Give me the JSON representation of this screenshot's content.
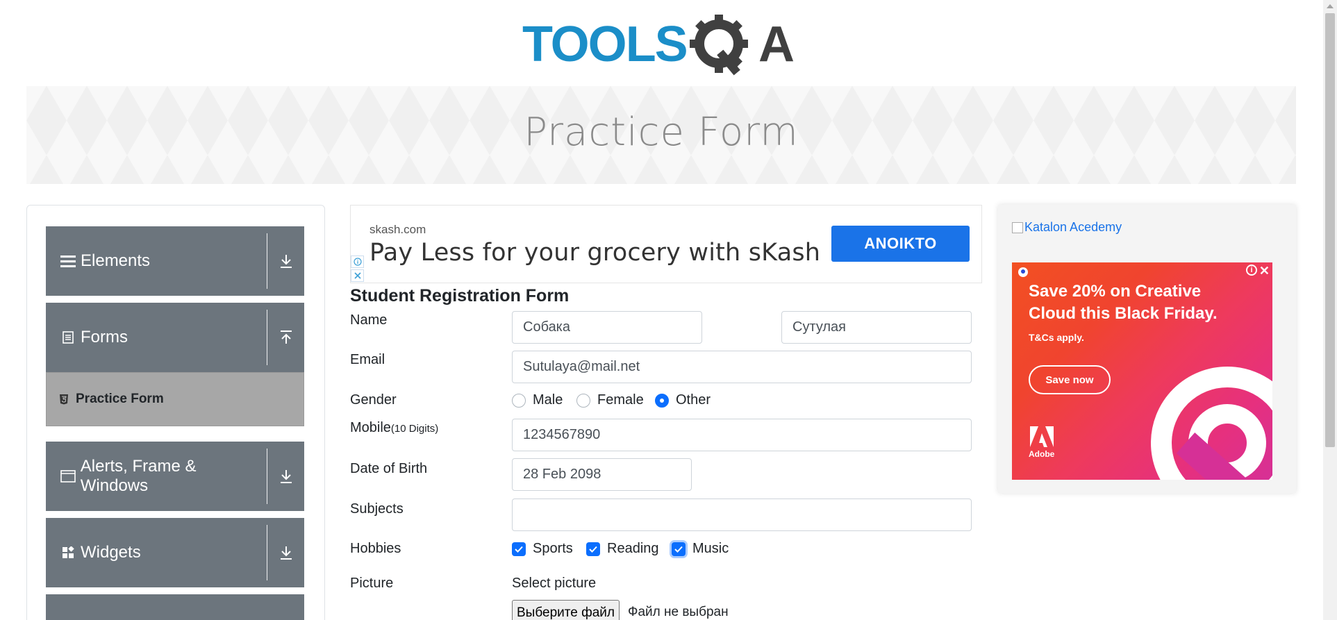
{
  "logo": {
    "text_tools": "TOOLS",
    "text_qa": "QA",
    "colors": {
      "tools": "#1b8ec8",
      "qa": "#404040"
    }
  },
  "page_title": "Practice Form",
  "sidebar": {
    "groups": [
      {
        "label": "Elements",
        "icon": "menu-icon",
        "arrow": "download-arrow-icon"
      },
      {
        "label": "Forms",
        "icon": "document-icon",
        "arrow": "upload-arrow-icon"
      },
      {
        "label": "Alerts, Frame & Windows",
        "icon": "window-icon",
        "arrow": "download-arrow-icon"
      },
      {
        "label": "Widgets",
        "icon": "widgets-icon",
        "arrow": "download-arrow-icon"
      }
    ],
    "active_item": {
      "label": "Practice Form",
      "icon": "html5-icon"
    }
  },
  "ad_top": {
    "source": "skash.com",
    "headline": "Pay Less for your grocery with sKash",
    "cta": "ΑΝΟΙΚΤΟ",
    "cta_color": "#1a73e8"
  },
  "form": {
    "title": "Student Registration Form",
    "name_label": "Name",
    "first_name": "Собака",
    "last_name": "Сутулая",
    "email_label": "Email",
    "email": "Sutulaya@mail.net",
    "gender_label": "Gender",
    "genders": [
      "Male",
      "Female",
      "Other"
    ],
    "gender_selected": "Other",
    "mobile_label": "Mobile",
    "mobile_hint": "(10 Digits)",
    "mobile": "1234567890",
    "dob_label": "Date of Birth",
    "dob": "28 Feb 2098",
    "subjects_label": "Subjects",
    "subjects_value": "",
    "hobbies_label": "Hobbies",
    "hobbies": [
      "Sports",
      "Reading",
      "Music"
    ],
    "hobbies_checked": [
      "Sports",
      "Reading",
      "Music"
    ],
    "picture_label": "Picture",
    "select_picture": "Select picture",
    "file_button": "Выберите файл",
    "file_status": "Файл не выбран",
    "accent_color": "#0b6efd"
  },
  "ad_right": {
    "katalon_alt": "Katalon Acedemy",
    "adobe_headline": "Save 20% on Creative Cloud this Black Friday.",
    "adobe_terms": "T&Cs apply.",
    "adobe_cta": "Save now",
    "adobe_brand": "Adobe"
  }
}
